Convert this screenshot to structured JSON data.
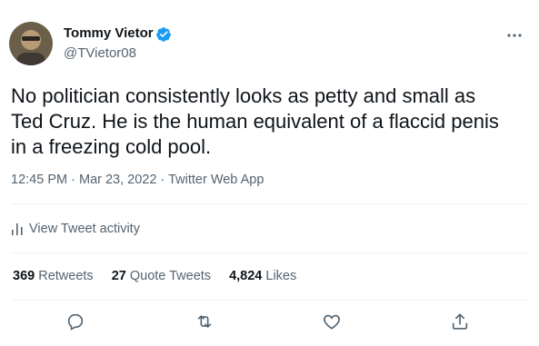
{
  "author": {
    "name": "Tommy Vietor",
    "handle": "@TVietor08"
  },
  "tweet": {
    "text": "No politician consistently looks as petty and small as\nTed Cruz. He is the human equivalent of a flaccid penis\nin a freezing cold pool.",
    "time": "12:45 PM",
    "separator": "·",
    "date": "Mar 23, 2022",
    "source": "Twitter Web App"
  },
  "activity": {
    "label": "View Tweet activity"
  },
  "stats": {
    "retweets_count": "369",
    "retweets_label": "Retweets",
    "quotes_count": "27",
    "quotes_label": "Quote Tweets",
    "likes_count": "4,824",
    "likes_label": "Likes"
  },
  "colors": {
    "text": "#0f1419",
    "secondary": "#536471",
    "verified": "#1d9bf0",
    "divider": "#eff3f4"
  },
  "icons": {
    "verified": "verified-badge-icon",
    "more": "more-dots-icon",
    "activity": "bar-chart-icon",
    "reply": "reply-icon",
    "retweet": "retweet-icon",
    "like": "heart-icon",
    "share": "share-icon"
  }
}
